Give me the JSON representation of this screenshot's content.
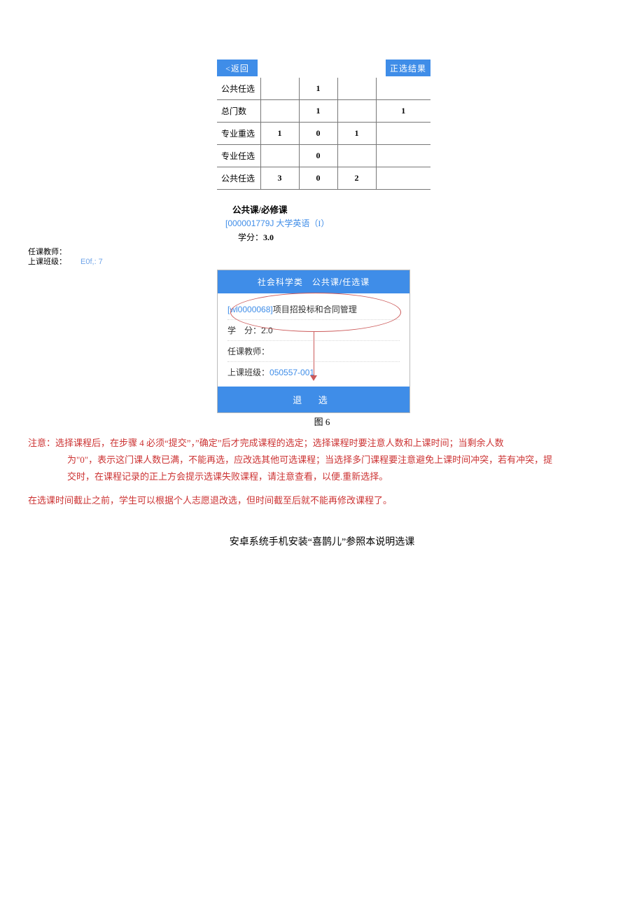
{
  "topbar": {
    "back": "<返回",
    "result": "正选结果"
  },
  "table": {
    "rows": [
      {
        "label": "公共任选",
        "c1": "",
        "c2": "1",
        "c3": "",
        "c4": ""
      },
      {
        "label": "总门数",
        "c1": "",
        "c2": "1",
        "c3": "",
        "c4": "1"
      },
      {
        "label": "专业重选",
        "c1": "1",
        "c2": "0",
        "c3": "1",
        "c4": ""
      },
      {
        "label": "专业任选",
        "c1": "",
        "c2": "0",
        "c3": "",
        "c4": ""
      },
      {
        "label": "公共任选",
        "c1": "3",
        "c2": "0",
        "c3": "2",
        "c4": ""
      }
    ]
  },
  "course": {
    "section_title": "公共课/必修课",
    "id_text": "[000001779J",
    "name_text": " 大学英语（I）",
    "credit_label": "学分：",
    "credit_value": "3.0"
  },
  "left": {
    "l1": "任课教师：",
    "l2": "上课班级：",
    "l2v": "E0f,: 7"
  },
  "card": {
    "header": "社会科学类　公共课/任选课",
    "course_id": "[wl0000068]",
    "course_name": "项目招投标和合同管理",
    "credit_label": "学　分：",
    "credit_value": "2.0",
    "teacher_label": "任课教师：",
    "class_label": "上课班级：",
    "class_value": "050557-001",
    "footer": "退 选"
  },
  "figcap": "图 6",
  "notes": {
    "red_line1a": "注意：选择课程后，在步骤 4 必须“提交”，”确定”后才完成课程的选定；选择课程时要注意人数和上课时间；当剩余人数",
    "red_line1b": "为\"0\"，表示这门课人数已满，不能再选，应改选其他可选课程；当选择多门课程要注意避免上课时间冲突，若有冲突，提",
    "red_line1c": "交时，在课程记录的正上方会提示选课失败课程，请注意查看，以便.重新选择。",
    "red_line2": "在选课时间截止之前，学生可以根据个人志愿退改选，但时间截至后就不能再修改课程了。"
  },
  "android": "安卓系统手机安装“喜鹊儿”参照本说明选课"
}
